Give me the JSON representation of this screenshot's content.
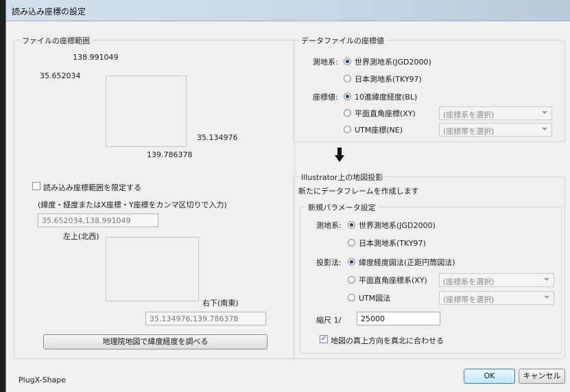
{
  "window": {
    "title": "読み込み座標の設定"
  },
  "file_range": {
    "label": "ファイルの座標範囲",
    "top_lon": "138.991049",
    "left_lat": "35.652034",
    "right_lat": "35.134976",
    "bottom_lon": "139.786378",
    "limit_checkbox": {
      "label": "読み込み座標範囲を限定する",
      "checked": false
    },
    "instruction": "(緯度・経度またはX座標・Y座標をカンマ区切りで入力)",
    "top_left_value": "35.652034,138.991049",
    "top_left_label": "左上(北西)",
    "bottom_right_label": "右下(南東)",
    "bottom_right_value": "35.134976,139.786378",
    "lookup_button": "地理院地図で緯度経度を調べる"
  },
  "data_file": {
    "label": "データファイルの座標値",
    "datum_label": "測地系:",
    "datum_options": [
      "世界測地系(JGD2000)",
      "日本測地系(TKY97)"
    ],
    "datum_selected": 0,
    "coord_label": "座標値:",
    "coord_options": [
      "10進緯度経度(BL)",
      "平面直角座標(XY)",
      "UTM座標(NE)"
    ],
    "coord_selected": 0,
    "xy_select": "(座標系を選択)",
    "utm_select": "(座標帯を選択)"
  },
  "projection": {
    "label": "Illustrator上の地図投影",
    "new_frame_text": "新たにデータフレームを作成します",
    "params_label": "新規パラメータ設定",
    "datum_label": "測地系:",
    "datum_options": [
      "世界測地系(JGD2000)",
      "日本測地系(TKY97)"
    ],
    "datum_selected": 0,
    "proj_label": "投影法:",
    "proj_options": [
      "緯度経度図法(正距円筒図法)",
      "平面直角座標系(XY)",
      "UTM図法"
    ],
    "proj_selected": 0,
    "xy_select": "(座標系を選択)",
    "utm_select": "(座標帯を選択)",
    "scale_label": "縮尺  1/",
    "scale_value": "25000",
    "north_checkbox": {
      "label": "地図の真上方向を真北に合わせる",
      "checked": true
    }
  },
  "footer": {
    "brand": "PlugX-Shape",
    "ok": "OK",
    "cancel": "キャンセル"
  }
}
